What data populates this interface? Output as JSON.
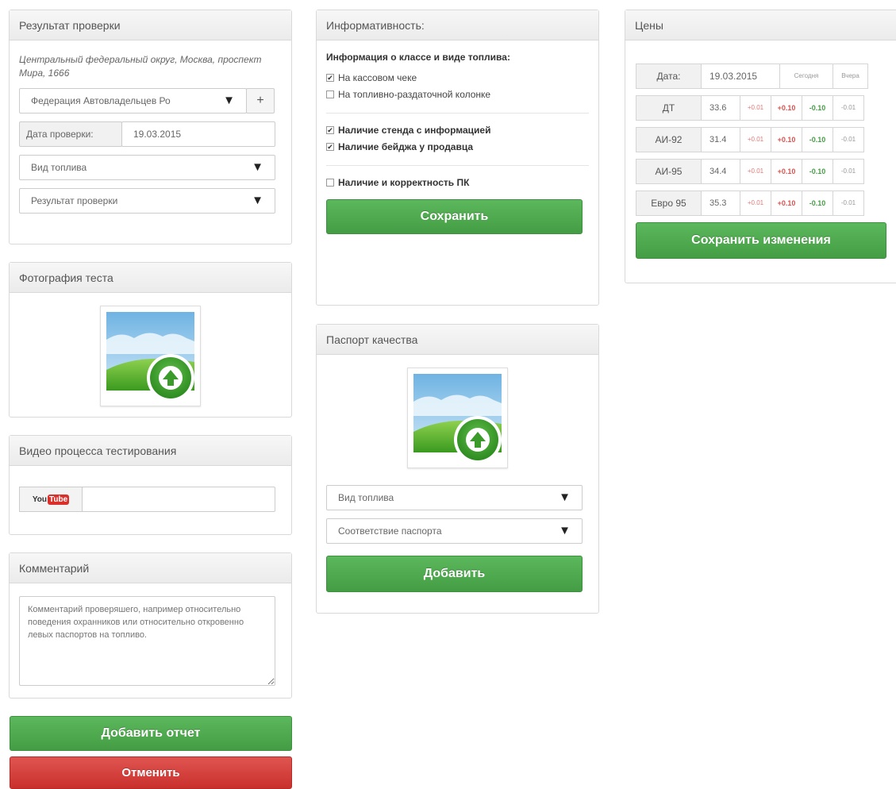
{
  "colors": {
    "green": "#5cb85c",
    "red": "#d9534f",
    "panel_head": "#f0f0f0"
  },
  "result": {
    "title": "Результат проверки",
    "address": "Центральный федеральный округ, Москва, проспект Мира, 1666",
    "org_select": "Федерация Автовладельцев Ро",
    "add_label": "+",
    "date_label": "Дата проверки:",
    "date_value": "19.03.2015",
    "fuel_select": "Вид топлива",
    "result_select": "Результат проверки"
  },
  "photo": {
    "title": "Фотография теста",
    "upload_icon": "upload-image-icon"
  },
  "video": {
    "title": "Видео процесса тестирования",
    "you": "You",
    "tube": "Tube",
    "input_value": ""
  },
  "comment": {
    "title": "Комментарий",
    "placeholder": "Комментарий проверяшего, например относительно поведения охранников или относительно откровенно левых паспортов на топливо."
  },
  "actions": {
    "add_report": "Добавить отчет",
    "cancel": "Отменить"
  },
  "info": {
    "title": "Информативность:",
    "subtitle": "Информация о классе и виде топлива:",
    "checks": [
      {
        "label": "На кассовом чеке",
        "checked": true,
        "bold": false
      },
      {
        "label": "На топливно-раздаточной колонке",
        "checked": false,
        "bold": false
      },
      {
        "label": "Наличие стенда с информацией",
        "checked": true,
        "bold": true
      },
      {
        "label": "Наличие бейджа у продавца",
        "checked": true,
        "bold": true
      },
      {
        "label": "Наличие и корректность ПК",
        "checked": false,
        "bold": true
      }
    ],
    "save": "Сохранить"
  },
  "passport": {
    "title": "Паспорт качества",
    "upload_icon": "upload-image-icon",
    "fuel_select": "Вид топлива",
    "match_select": "Соответствие паспорта",
    "add": "Добавить"
  },
  "prices": {
    "title": "Цены",
    "date_label": "Дата:",
    "date_value": "19.03.2015",
    "today": "Сегодня",
    "yesterday": "Вчера",
    "rows": [
      {
        "fuel": "ДТ",
        "value": "33.6",
        "a": "+0.01",
        "b": "+0.10",
        "c": "-0.10",
        "d": "-0.01"
      },
      {
        "fuel": "АИ-92",
        "value": "31.4",
        "a": "+0.01",
        "b": "+0.10",
        "c": "-0.10",
        "d": "-0.01"
      },
      {
        "fuel": "АИ-95",
        "value": "34.4",
        "a": "+0.01",
        "b": "+0.10",
        "c": "-0.10",
        "d": "-0.01"
      },
      {
        "fuel": "Евро 95",
        "value": "35.3",
        "a": "+0.01",
        "b": "+0.10",
        "c": "-0.10",
        "d": "-0.01"
      }
    ],
    "save": "Сохранить изменения"
  }
}
